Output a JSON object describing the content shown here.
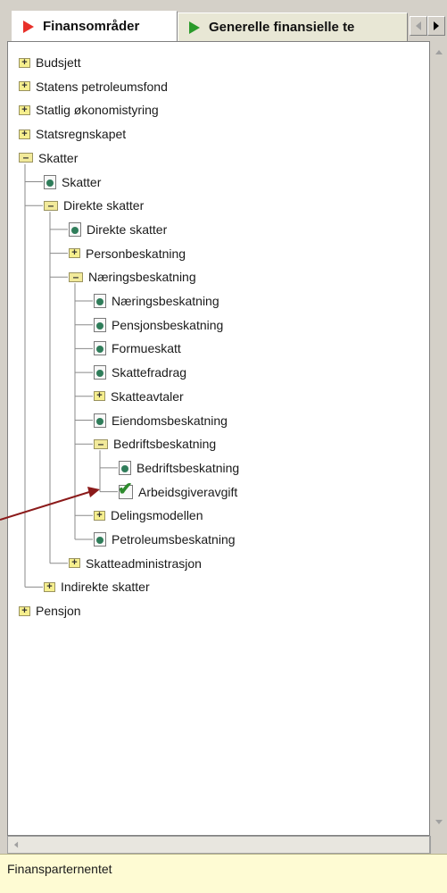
{
  "tabs": [
    {
      "label": "Finansområder",
      "icon": "red-play-icon",
      "color": "#e8302a",
      "active": true
    },
    {
      "label": "Generelle finansielle te",
      "icon": "green-play-icon",
      "color": "#2a9a2a",
      "active": false
    }
  ],
  "tree": [
    {
      "label": "Budsjett",
      "type": "expand",
      "level": 0
    },
    {
      "label": "Statens petroleumsfond",
      "type": "expand",
      "level": 0
    },
    {
      "label": "Statlig økonomistyring",
      "type": "expand",
      "level": 0
    },
    {
      "label": "Statsregnskapet",
      "type": "expand",
      "level": 0
    },
    {
      "label": "Skatter",
      "type": "open",
      "level": 0
    },
    {
      "label": "Skatter",
      "type": "doc",
      "level": 1
    },
    {
      "label": "Direkte skatter",
      "type": "open",
      "level": 1
    },
    {
      "label": "Direkte skatter",
      "type": "doc",
      "level": 2
    },
    {
      "label": "Personbeskatning",
      "type": "expand",
      "level": 2
    },
    {
      "label": "Næringsbeskatning",
      "type": "open",
      "level": 2
    },
    {
      "label": "Næringsbeskatning",
      "type": "doc",
      "level": 3
    },
    {
      "label": "Pensjonsbeskatning",
      "type": "doc",
      "level": 3
    },
    {
      "label": "Formueskatt",
      "type": "doc",
      "level": 3
    },
    {
      "label": "Skattefradrag",
      "type": "doc",
      "level": 3
    },
    {
      "label": "Skatteavtaler",
      "type": "expand",
      "level": 3
    },
    {
      "label": "Eiendomsbeskatning",
      "type": "doc",
      "level": 3
    },
    {
      "label": "Bedriftsbeskatning",
      "type": "open",
      "level": 3
    },
    {
      "label": "Bedriftsbeskatning",
      "type": "doc",
      "level": 4
    },
    {
      "label": "Arbeidsgiveravgift",
      "type": "check",
      "level": 4
    },
    {
      "label": "Delingsmodellen",
      "type": "expand",
      "level": 3
    },
    {
      "label": "Petroleumsbeskatning",
      "type": "doc",
      "level": 3
    },
    {
      "label": "Skatteadministrasjon",
      "type": "expand",
      "level": 2
    },
    {
      "label": "Indirekte skatter",
      "type": "expand",
      "level": 1
    },
    {
      "label": "Pensjon",
      "type": "expand",
      "level": 0
    }
  ],
  "status": {
    "text": "Finansparternentet"
  },
  "colors": {
    "tree_line": "#8a8a8a",
    "arrow": "#8b1a1a",
    "status_bg": "#fefbd3"
  }
}
